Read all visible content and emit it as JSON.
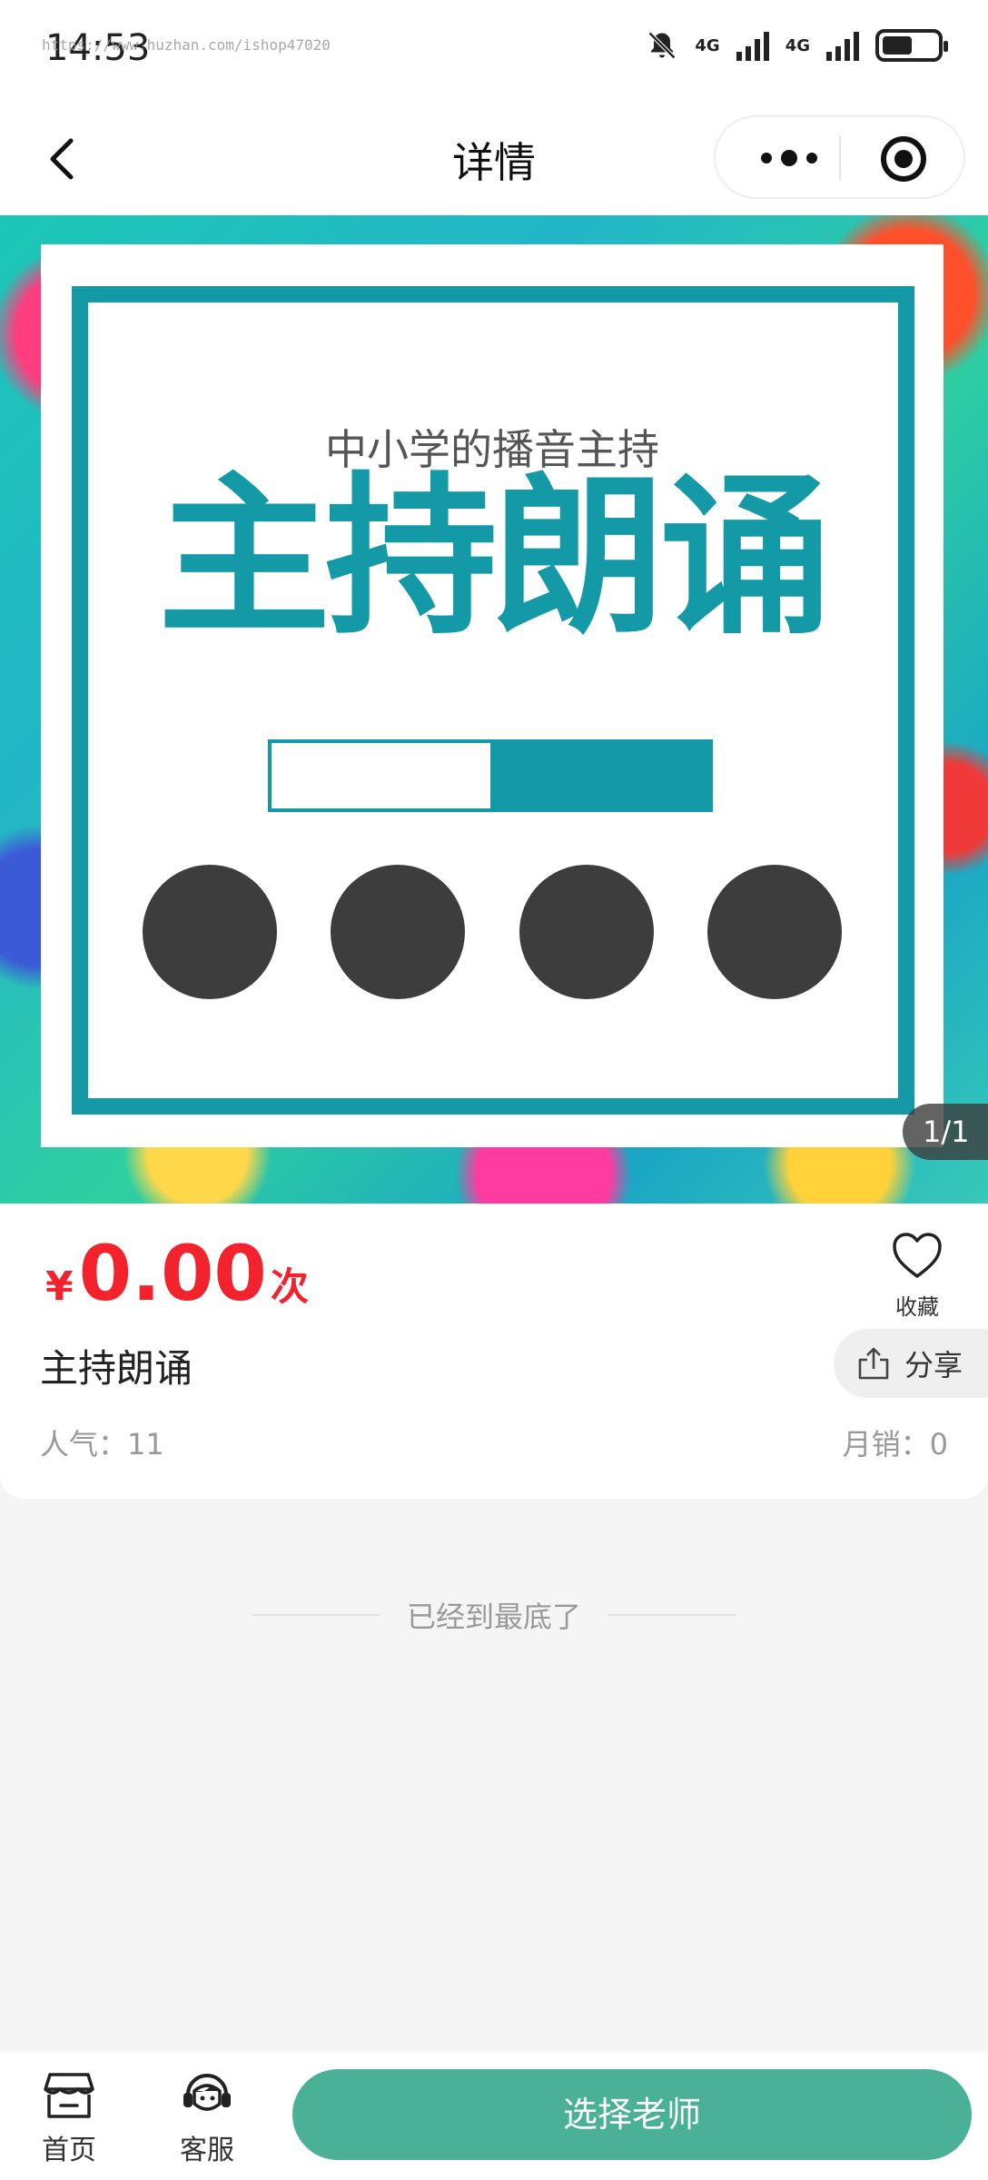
{
  "status_bar": {
    "time": "14:53",
    "url_watermark": "https://www.huzhan.com/ishop47020",
    "network1": "4G",
    "network2": "4G",
    "battery_percent": 55
  },
  "nav": {
    "title": "详情"
  },
  "banner": {
    "subtitle": "中小学的播音主持",
    "main_title": "主持朗诵",
    "progress_fill": 0.5,
    "counter": "1/1"
  },
  "product": {
    "currency": "¥",
    "price": "0.00",
    "unit": "次",
    "favorite_label": "收藏",
    "title": "主持朗诵",
    "share_label": "分享",
    "popularity": "人气：11",
    "monthly_sales": "月销：0"
  },
  "end_note": "已经到最底了",
  "bottom_bar": {
    "home_label": "首页",
    "service_label": "客服",
    "cta_label": "选择老师"
  },
  "colors": {
    "price": "#f4222d",
    "accent": "#4bb196",
    "poster_teal": "#139aa6"
  }
}
